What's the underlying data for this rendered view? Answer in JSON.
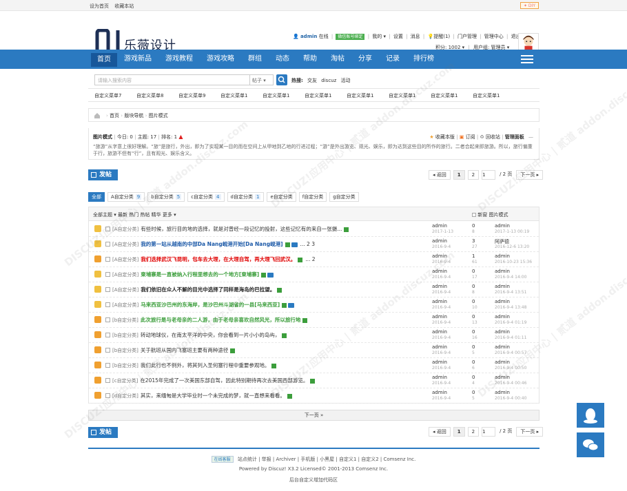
{
  "topbar": {
    "set_home": "设为首页",
    "favorite": "收藏本站",
    "diy": "✦ DIY"
  },
  "header": {
    "logo_text": "乐薇设计",
    "user": "admin",
    "online": "在线",
    "wx_bind": "微信账号绑定",
    "my": "我的",
    "settings": "设置",
    "messages": "消息",
    "reminders": "提醒(1)",
    "portal": "门户管理",
    "admin_center": "管理中心",
    "logout": "退出",
    "points": "积分: 1002",
    "usergroup": "用户组: 管理员"
  },
  "nav": [
    "首页",
    "游戏新品",
    "游戏教程",
    "游戏攻略",
    "群组",
    "动态",
    "帮助",
    "淘帖",
    "分享",
    "记录",
    "排行榜"
  ],
  "search": {
    "placeholder": "请输入搜索内容",
    "type": "帖子",
    "hot_label": "热搜:",
    "hot": [
      "交友",
      "discuz",
      "活动"
    ]
  },
  "custom_menu": [
    "自定义菜单7",
    "自定义菜单8",
    "自定义菜单9",
    "自定义菜单1",
    "自定义菜单1",
    "自定义菜单1",
    "自定义菜单1",
    "自定义菜单1",
    "自定义菜单1",
    "自定义菜单1"
  ],
  "breadcrumb": {
    "home": "首页",
    "forum": "版块导航",
    "mode": "图片模式"
  },
  "forum": {
    "name": "图片模式",
    "today": "今日: 0",
    "topics": "主题: 17",
    "rank": "排名: 1",
    "fav": "收藏本版",
    "rss": "订阅",
    "recycle": "回收站",
    "manage": "管理面板",
    "desc": "“旅游”从字意上很好理解。“旅”是旅行，外出，即为了实现某一目的而在空间上从甲地到乙地的行进过程；“游”是外出游览、观光、娱乐，即为达到这些目的所作的旅行。二者合起来即旅游。所以，旅行偏重于行，旅游不但有“行”，且有观光、娱乐含义。"
  },
  "post_btn": "发帖",
  "pager": {
    "prev": "◂ 返回",
    "p1": "1",
    "p2": "2",
    "input": "1",
    "total": "/ 2 页",
    "next": "下一页 ▸"
  },
  "types": [
    {
      "label": "全部",
      "count": ""
    },
    {
      "label": "A自定分类",
      "count": "9"
    },
    {
      "label": "b自定分类",
      "count": "5"
    },
    {
      "label": "c自定分类",
      "count": "4"
    },
    {
      "label": "d自定分类",
      "count": "1"
    },
    {
      "label": "e自定分类",
      "count": ""
    },
    {
      "label": "f自定分类",
      "count": ""
    },
    {
      "label": "g自定分类",
      "count": ""
    }
  ],
  "list_header": {
    "filters": "全部主题 ▾   最新  热门  热帖  精华  更多 ▾",
    "options": "新窗      图片模式"
  },
  "threads": [
    {
      "cat": "[A自定分类]",
      "title": "有些时候，旅行目的地的选择，就是对曾经一段记忆的投射，这些记忆有的来自一张摄...",
      "color": "#333",
      "author": "admin",
      "date": "2017-1-13",
      "replies": "0",
      "views": "8",
      "last_user": "admin",
      "last_date": "2017-1-13 00:19",
      "extra": "",
      "icon": "#f0c040"
    },
    {
      "cat": "[A自定分类]",
      "title": "我的第一站从越南的中部Da Nang岘港开始[Da Nang岘港]",
      "color": "#1d5aa8",
      "author": "admin",
      "date": "2016-9-4",
      "replies": "3",
      "views": "27",
      "last_user": "阿萨德",
      "last_date": "2016-12-6 13:20",
      "extra": "... 2  3",
      "icon": "#f0c040"
    },
    {
      "cat": "[A自定分类]",
      "title": "我们选择武汉飞昆明，包车去大理，在大理自驾，再大理飞回武汉。",
      "color": "#e00000",
      "author": "admin",
      "date": "2016-9-4",
      "replies": "1",
      "views": "61",
      "last_user": "admin",
      "last_date": "2016-10-23 15:36",
      "extra": "... 2",
      "icon": "#f0a030"
    },
    {
      "cat": "[A自定分类]",
      "title": "柬埔寨是一直被纳入行程里想去的一个地方[柬埔寨]",
      "color": "#3c9e3c",
      "author": "admin",
      "date": "2016-9-4",
      "replies": "0",
      "views": "17",
      "last_user": "admin",
      "last_date": "2016-9-4 14:00",
      "extra": "",
      "icon": "#f0c040"
    },
    {
      "cat": "[A自定分类]",
      "title": "我们依旧在众人不解的目光中选择了同样是海岛的巴拉望。",
      "color": "#222",
      "author": "admin",
      "date": "2016-9-4",
      "replies": "0",
      "views": "8",
      "last_user": "admin",
      "last_date": "2016-9-4 13:51",
      "extra": "",
      "icon": "#f0c040"
    },
    {
      "cat": "[A自定分类]",
      "title": "马来西亚沙巴州的东海岸，是沙巴州斗湖省的一县[马来西亚]",
      "color": "#3c9e3c",
      "author": "admin",
      "date": "2016-9-4",
      "replies": "0",
      "views": "10",
      "last_user": "admin",
      "last_date": "2016-9-4 13:48",
      "extra": "",
      "icon": "#f0c040"
    },
    {
      "cat": "[b自定分类]",
      "title": "此次旅行是与老母亲的二人游，由于老母亲喜欢自然风光，所以旅行地",
      "color": "#3c9e3c",
      "author": "admin",
      "date": "2016-9-4",
      "replies": "0",
      "views": "13",
      "last_user": "admin",
      "last_date": "2016-9-4 01:19",
      "extra": "",
      "icon": "#f0a030"
    },
    {
      "cat": "[b自定分类]",
      "title": "转动地球仪，在南太平洋的中央，你会看到一片小小的岛屿，",
      "color": "#333",
      "author": "admin",
      "date": "2016-9-4",
      "replies": "0",
      "views": "16",
      "last_user": "admin",
      "last_date": "2016-9-4 01:11",
      "extra": "",
      "icon": "#f0a030"
    },
    {
      "cat": "[b自定分类]",
      "title": "关于航班从国内飞塞班主要有两种途径",
      "color": "#333",
      "author": "admin",
      "date": "2016-9-4",
      "replies": "0",
      "views": "5",
      "last_user": "admin",
      "last_date": "2016-9-4 00:57",
      "extra": "",
      "icon": "#f0a030"
    },
    {
      "cat": "[b自定分类]",
      "title": "我们此行也不例外，将其列入圣何塞行程中重要参观地。",
      "color": "#333",
      "author": "admin",
      "date": "2016-9-4",
      "replies": "0",
      "views": "6",
      "last_user": "admin",
      "last_date": "2016-9-4 00:50",
      "extra": "",
      "icon": "#f0a030"
    },
    {
      "cat": "[c自定分类]",
      "title": "在2015年完成了一次美国东部自驾，因此特别期待再次去美国西部游览。",
      "color": "#333",
      "author": "admin",
      "date": "2016-9-4",
      "replies": "0",
      "views": "4",
      "last_user": "admin",
      "last_date": "2016-9-4 00:46",
      "extra": "",
      "icon": "#f0a030"
    },
    {
      "cat": "[d自定分类]",
      "title": "其实，来缅甸是大学毕业时一个未完成的梦，就一直想来看看。",
      "color": "#333",
      "author": "admin",
      "date": "2016-9-4",
      "replies": "0",
      "views": "5",
      "last_user": "admin",
      "last_date": "2016-9-4 00:40",
      "extra": "",
      "icon": "#f0a030"
    }
  ],
  "next_page": "下一页 »",
  "footer": {
    "kf": "在线客服",
    "links": "站点统计  |  举报  |  Archiver  |  手机版  |  小黑屋  |  自定义1  |  自定义2  |  Comsenz Inc.",
    "powered": "Powered by Discuz! X3.2 Licensed© 2001-2013 Comsenz Inc.",
    "custom": "后台自定义增加代码区"
  },
  "watermark": "DISCUZ!应用中心 | 贰道 addon.discuz.com"
}
